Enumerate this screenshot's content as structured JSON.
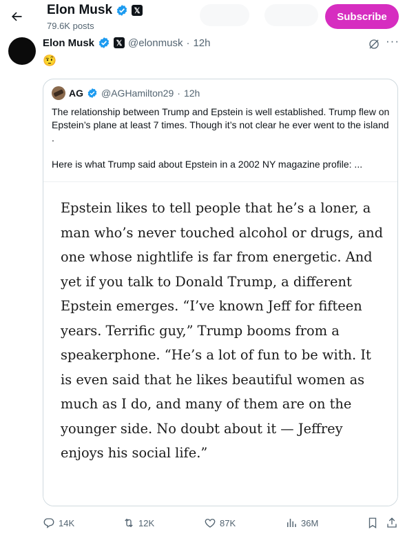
{
  "header": {
    "name": "Elon Musk",
    "posts_count": "79.6K posts",
    "subscribe_label": "Subscribe"
  },
  "post": {
    "name": "Elon Musk",
    "handle": "@elonmusk",
    "separator": "·",
    "time": "12h",
    "text": "🤨"
  },
  "quote": {
    "name": "AG",
    "handle": "@AGHamilton29",
    "separator": "·",
    "time": "12h",
    "paragraph1": "The relationship between Trump and Epstein is well established. Trump flew on Epstein’s plane at least 7 times. Though it’s not clear he ever went to the island .",
    "paragraph2": "Here is what Trump said about Epstein in a 2002 NY magazine profile: ...",
    "image_text": "Epstein likes to tell people that he’s a loner, a man who’s never touched alcohol or drugs, and one whose nightlife is far from energetic. And yet if you talk to Donald Trump, a different Epstein emerges. “I’ve known Jeff for fifteen years. Terrific guy,” Trump booms from a speakerphone. “He’s a lot of fun to be with. It is even said that he likes beautiful women as much as I do, and many of them are on the younger side. No doubt about it — Jeffrey enjoys his social life.”"
  },
  "actions": {
    "replies": "14K",
    "reposts": "12K",
    "likes": "87K",
    "views": "36M"
  },
  "icons": {
    "back": "arrow-left-icon",
    "verified": "verified-badge-icon",
    "affiliate": "x-affiliate-icon",
    "grok": "grok-icon",
    "more": "more-icon",
    "reply": "reply-icon",
    "repost": "repost-icon",
    "like": "heart-icon",
    "views": "views-icon",
    "bookmark": "bookmark-icon",
    "share": "share-icon"
  },
  "colors": {
    "subscribe": "#d62dc0",
    "verified": "#1d9bf0",
    "secondary_text": "#536471",
    "border": "#cfd9de"
  }
}
